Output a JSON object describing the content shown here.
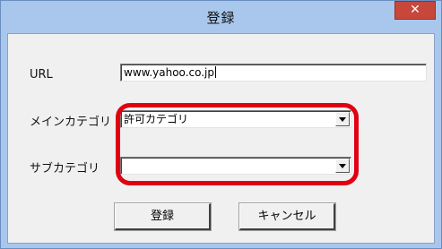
{
  "dialog": {
    "title": "登録",
    "close_glyph": "✕",
    "url_label": "URL",
    "url_value": "www.yahoo.co.jp",
    "main_category_label": "メインカテゴリ",
    "main_category_value": "許可カテゴリ",
    "sub_category_label": "サブカテゴリ",
    "sub_category_value": "",
    "register_button": "登録",
    "cancel_button": "キャンセル"
  },
  "colors": {
    "titlebar": "#a9c7ec",
    "close_button": "#c7473b",
    "annotation": "#e00012"
  },
  "icons": {
    "close": "close-icon",
    "dropdown": "chevron-down-icon"
  }
}
